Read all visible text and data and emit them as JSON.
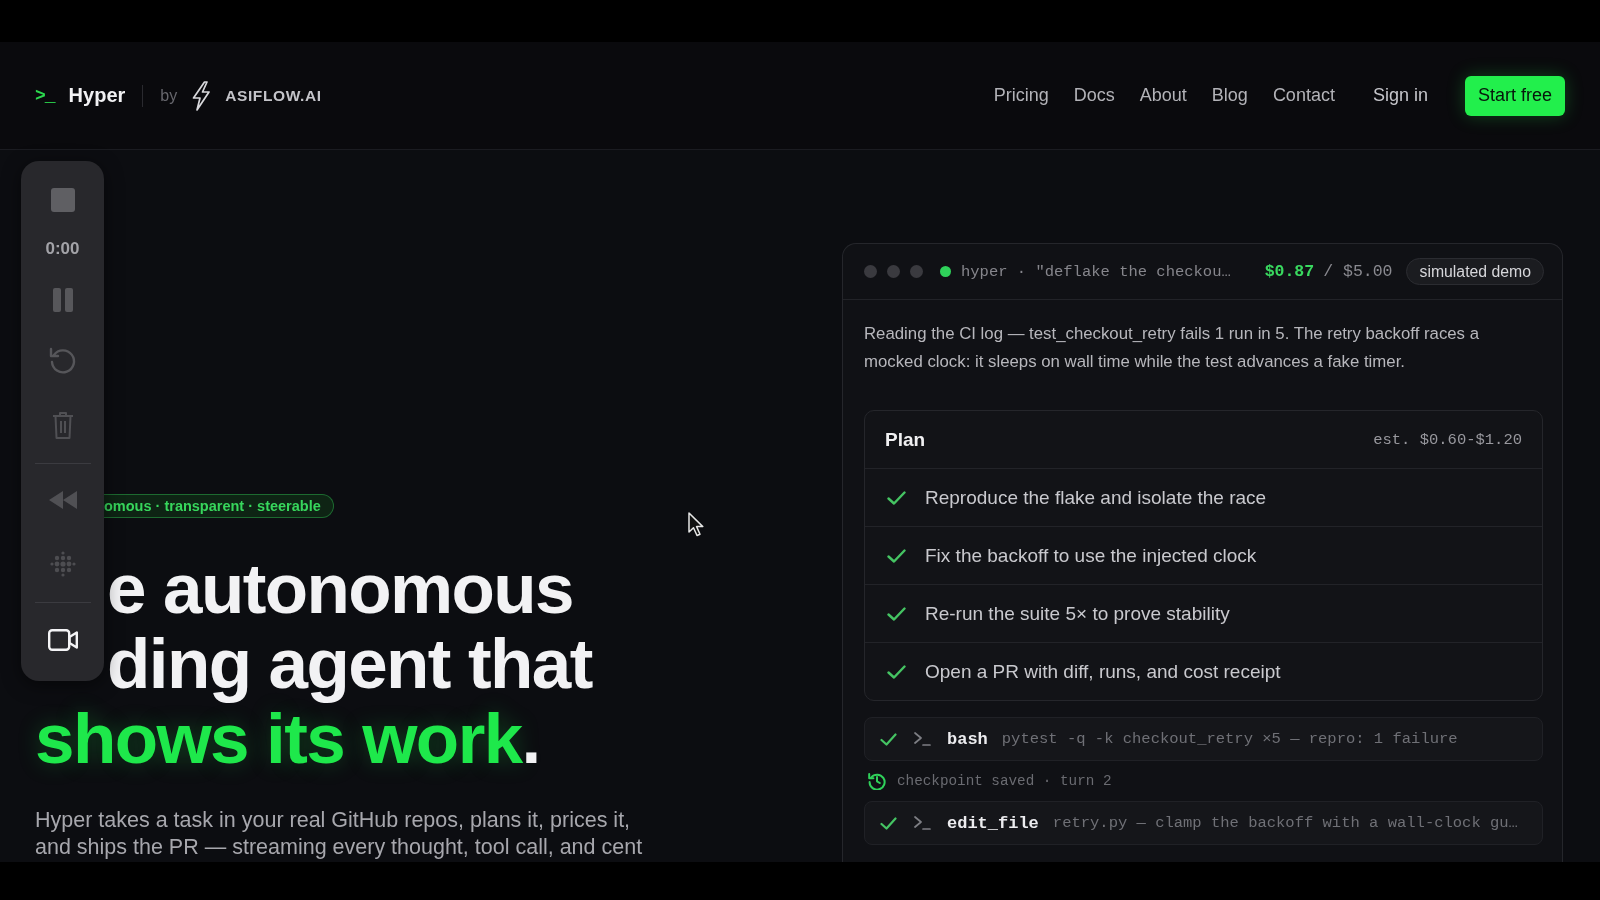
{
  "header": {
    "logo": {
      "prompt": ">_",
      "name": "Hyper",
      "by": "by",
      "partner": "ASIFLOW.AI"
    },
    "nav": [
      "Pricing",
      "Docs",
      "About",
      "Blog",
      "Contact"
    ],
    "sign_in": "Sign in",
    "cta": "Start free"
  },
  "recorder": {
    "time": "0:00",
    "camera_on": true
  },
  "hero": {
    "tagline": "omous · transparent · steerable",
    "heading": {
      "lines": [
        "e autonomous",
        "ding agent that"
      ],
      "highlight": "shows its work",
      "end": "."
    },
    "description": "Hyper takes a task in your real GitHub repos, plans it, prices it, and ships the PR — streaming every thought, tool call, and cent"
  },
  "session": {
    "title": "hyper · \"deflake the checkou…",
    "spent": "$0.87",
    "budget": "/ $5.00",
    "badge": "simulated demo",
    "message": "Reading the CI log — test_checkout_retry fails 1 run in 5. The retry backoff races a mocked clock: it sleeps on wall time while the test advances a fake timer.",
    "plan": {
      "title": "Plan",
      "estimate": "est. $0.60-$1.20",
      "steps": [
        {
          "text": "Reproduce the flake and isolate the race",
          "done": true
        },
        {
          "text": "Fix the backoff to use the injected clock",
          "done": true
        },
        {
          "text": "Re-run the suite 5× to prove stability",
          "done": true
        },
        {
          "text": "Open a PR with diff, runs, and cost receipt",
          "done": true
        }
      ]
    },
    "log": [
      {
        "kind": "tool",
        "done": true,
        "tool": "bash",
        "detail": "pytest -q -k checkout_retry ×5 — repro: 1 failure"
      },
      {
        "kind": "checkpoint",
        "text": "checkpoint saved · turn 2"
      },
      {
        "kind": "tool",
        "done": true,
        "tool": "edit_file",
        "detail": "retry.py — clamp the backoff with a wall-clock gu…"
      }
    ]
  }
}
